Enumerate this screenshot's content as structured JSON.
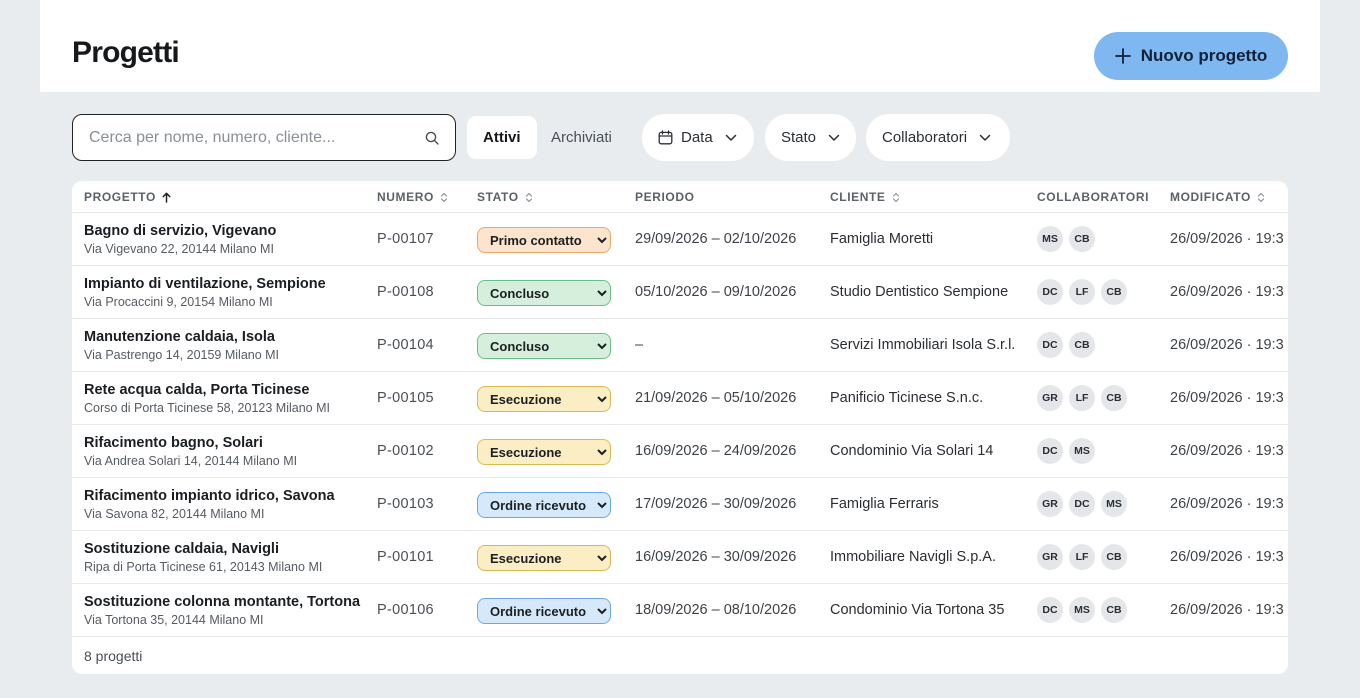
{
  "header": {
    "title": "Progetti",
    "new_button_label": "Nuovo progetto"
  },
  "toolbar": {
    "search_placeholder": "Cerca per nome, numero, cliente...",
    "tabs": [
      {
        "label": "Attivi",
        "active": true
      },
      {
        "label": "Archiviati",
        "active": false
      }
    ],
    "filters": {
      "date": "Data",
      "status": "Stato",
      "collaborators": "Collaboratori"
    }
  },
  "table": {
    "headers": {
      "project": "PROGETTO",
      "number": "NUMERO",
      "status": "STATO",
      "period": "PERIODO",
      "client": "CLIENTE",
      "collaborators": "COLLABORATORI",
      "modified": "MODIFICATO"
    },
    "status_options": [
      "Primo contatto",
      "Ordine ricevuto",
      "Esecuzione",
      "Concluso"
    ],
    "status_colors": {
      "Primo contatto": {
        "bg": "#fde4cc",
        "border": "#e8a868"
      },
      "Concluso": {
        "bg": "#d6efdc",
        "border": "#6bbf83"
      },
      "Esecuzione": {
        "bg": "#fbeec4",
        "border": "#dcb854"
      },
      "Ordine ricevuto": {
        "bg": "#d6e9fb",
        "border": "#6aa9e8"
      }
    },
    "rows": [
      {
        "name": "Bagno di servizio, Vigevano",
        "address": "Via Vigevano 22, 20144 Milano MI",
        "number": "P-00107",
        "status": "Primo contatto",
        "period": "29/09/2026 – 02/10/2026",
        "client": "Famiglia Moretti",
        "collaborators": [
          "MS",
          "CB"
        ],
        "modified": "26/09/2026 · 19:3"
      },
      {
        "name": "Impianto di ventilazione, Sempione",
        "address": "Via Procaccini 9, 20154 Milano MI",
        "number": "P-00108",
        "status": "Concluso",
        "period": "05/10/2026 – 09/10/2026",
        "client": "Studio Dentistico Sempione",
        "collaborators": [
          "DC",
          "LF",
          "CB"
        ],
        "modified": "26/09/2026 · 19:3"
      },
      {
        "name": "Manutenzione caldaia, Isola",
        "address": "Via Pastrengo 14, 20159 Milano MI",
        "number": "P-00104",
        "status": "Concluso",
        "period": "–",
        "client": "Servizi Immobiliari Isola S.r.l.",
        "collaborators": [
          "DC",
          "CB"
        ],
        "modified": "26/09/2026 · 19:3"
      },
      {
        "name": "Rete acqua calda, Porta Ticinese",
        "address": "Corso di Porta Ticinese 58, 20123 Milano MI",
        "number": "P-00105",
        "status": "Esecuzione",
        "period": "21/09/2026 – 05/10/2026",
        "client": "Panificio Ticinese S.n.c.",
        "collaborators": [
          "GR",
          "LF",
          "CB"
        ],
        "modified": "26/09/2026 · 19:3"
      },
      {
        "name": "Rifacimento bagno, Solari",
        "address": "Via Andrea Solari 14, 20144 Milano MI",
        "number": "P-00102",
        "status": "Esecuzione",
        "period": "16/09/2026 – 24/09/2026",
        "client": "Condominio Via Solari 14",
        "collaborators": [
          "DC",
          "MS"
        ],
        "modified": "26/09/2026 · 19:3"
      },
      {
        "name": "Rifacimento impianto idrico, Savona",
        "address": "Via Savona 82, 20144 Milano MI",
        "number": "P-00103",
        "status": "Ordine ricevuto",
        "period": "17/09/2026 – 30/09/2026",
        "client": "Famiglia Ferraris",
        "collaborators": [
          "GR",
          "DC",
          "MS"
        ],
        "modified": "26/09/2026 · 19:3"
      },
      {
        "name": "Sostituzione caldaia, Navigli",
        "address": "Ripa di Porta Ticinese 61, 20143 Milano MI",
        "number": "P-00101",
        "status": "Esecuzione",
        "period": "16/09/2026 – 30/09/2026",
        "client": "Immobiliare Navigli S.p.A.",
        "collaborators": [
          "GR",
          "LF",
          "CB"
        ],
        "modified": "26/09/2026 · 19:3"
      },
      {
        "name": "Sostituzione colonna montante, Tortona",
        "address": "Via Tortona 35, 20144 Milano MI",
        "number": "P-00106",
        "status": "Ordine ricevuto",
        "period": "18/09/2026 – 08/10/2026",
        "client": "Condominio Via Tortona 35",
        "collaborators": [
          "DC",
          "MS",
          "CB"
        ],
        "modified": "26/09/2026 · 19:3"
      }
    ],
    "footer_count": "8 progetti"
  },
  "colors": {
    "accent": "#7fb8f0",
    "background": "#e9ecef"
  }
}
